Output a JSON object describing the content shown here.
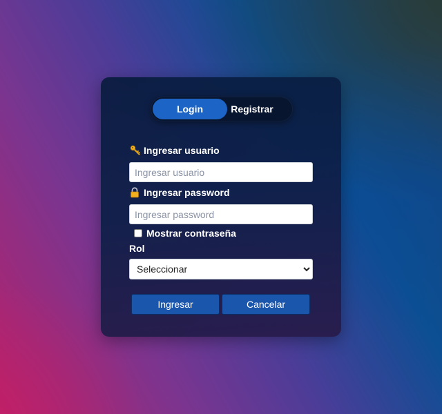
{
  "tabs": {
    "login_label": "Login",
    "register_label": "Registrar"
  },
  "form": {
    "username": {
      "label": "Ingresar usuario",
      "placeholder": "Ingresar usuario",
      "value": "",
      "icon": "key-icon"
    },
    "password": {
      "label": "Ingresar password",
      "placeholder": "Ingresar password",
      "value": "",
      "icon": "lock-icon"
    },
    "show_password": {
      "label": "Mostrar contraseña",
      "checked": false
    },
    "role": {
      "label": "Rol",
      "selected": "Seleccionar"
    }
  },
  "buttons": {
    "submit_label": "Ingresar",
    "cancel_label": "Cancelar"
  },
  "colors": {
    "tab_active": "#1c64c6",
    "button": "#1b56ad",
    "icon_gold": "#f2b01e"
  }
}
